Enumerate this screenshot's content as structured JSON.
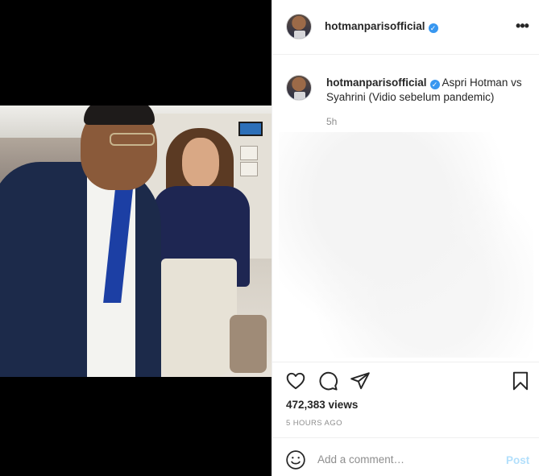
{
  "post": {
    "username": "hotmanparisofficial",
    "verified_icon": "verified-badge-icon",
    "more_icon": "more-options-icon",
    "caption_text": "Aspri Hotman vs Syahrini (Vidio sebelum pandemic)",
    "caption_time": "5h",
    "views": "472,383 views",
    "timestamp": "5 HOURS AGO"
  },
  "actions": {
    "like_icon": "heart-icon",
    "comment_icon": "comment-bubble-icon",
    "share_icon": "paper-plane-icon",
    "save_icon": "bookmark-icon"
  },
  "comment": {
    "emoji_icon": "smiley-icon",
    "placeholder": "Add a comment…",
    "post_label": "Post"
  },
  "colors": {
    "verified": "#3897f0",
    "post_disabled": "#b2dffc",
    "muted_text": "#8e8e8e"
  }
}
